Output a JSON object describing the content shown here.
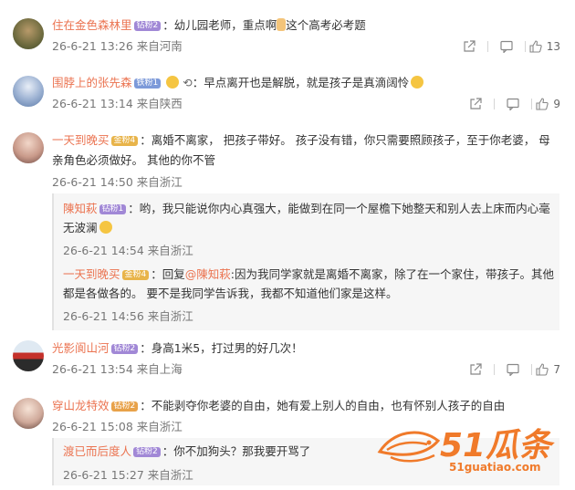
{
  "comments": [
    {
      "user": "住在金色森林里",
      "badge": "钻粉2",
      "text_before": "：幼儿园老师，重点啊",
      "text_after": "这个高考必考题",
      "time": "26-6-21 13:26 来自河南",
      "likes": "13"
    },
    {
      "user": "围脖上的张先森",
      "badge": "铁粉1",
      "text": "：早点离开也是解脱，就是孩子是真滴阔怜",
      "time": "26-6-21 13:14 来自陕西",
      "likes": "9"
    },
    {
      "user": "一天到晚买",
      "badge": "金粉4",
      "text": "：离婚不离家， 把孩子带好。 孩子没有错，你只需要照顾孩子，至于你老婆， 母亲角色必须做好。 其他的你不管",
      "time": "26-6-21 14:50 来自浙江",
      "replies": [
        {
          "user": "陳知萩",
          "badge": "钻粉1",
          "text": "：哟，我只能说你内心真强大，能做到在同一个屋檐下她整天和别人去上床而内心毫无波澜",
          "time": "26-6-21 14:54 来自浙江"
        },
        {
          "user": "一天到晚买",
          "badge": "金粉4",
          "reply_prefix": "：回复",
          "mention": "@陳知萩",
          "text": ":因为我同学家就是离婚不离家，除了在一个家住，带孩子。其他都是各做各的。 要不是我同学告诉我，我都不知道他们家是这样。",
          "time": "26-6-21 14:56 来自浙江"
        }
      ]
    },
    {
      "user": "光影阆山河",
      "badge": "钻粉2",
      "text": "：身高1米5，打过男的好几次！",
      "time": "26-6-21 13:54 来自上海",
      "likes": "7"
    },
    {
      "user": "穿山龙特效",
      "badge": "钻粉2",
      "text": "：不能剥夺你老婆的自由，她有爱上别人的自由，也有怀别人孩子的自由",
      "time": "26-6-21 15:08 来自浙江",
      "replies": [
        {
          "user": "渡已而后度人",
          "badge": "钻粉2",
          "text": "：你不加狗头？那我要开骂了",
          "time": "26-6-21 15:27 来自浙江"
        }
      ]
    }
  ],
  "watermark": {
    "brand": "51瓜条",
    "site": "51guatiao.com"
  },
  "colors": {
    "username": "#eb7350",
    "meta": "#777777",
    "reply_bg": "#f6f6f6"
  }
}
